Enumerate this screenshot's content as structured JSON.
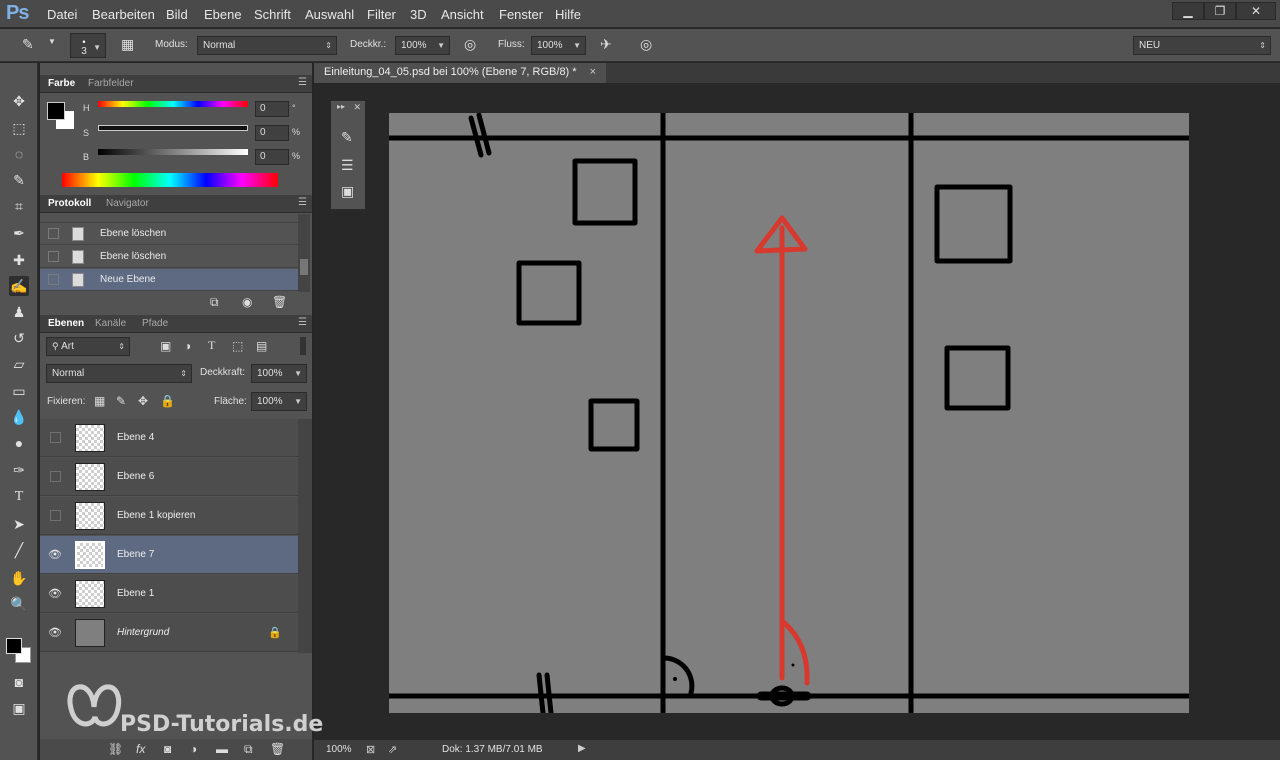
{
  "app": {
    "logo": "Ps"
  },
  "menubar": {
    "items": [
      "Datei",
      "Bearbeiten",
      "Bild",
      "Ebene",
      "Schrift",
      "Auswahl",
      "Filter",
      "3D",
      "Ansicht",
      "Fenster",
      "Hilfe"
    ]
  },
  "window_controls": {
    "minimize": "▁",
    "restore": "❐",
    "close": "✕"
  },
  "options_bar": {
    "brush_size": "3",
    "mode_label": "Modus:",
    "mode_value": "Normal",
    "opacity_label": "Deckkr.:",
    "opacity_value": "100%",
    "flow_label": "Fluss:",
    "flow_value": "100%",
    "workspace_value": "NEU"
  },
  "color_panel": {
    "tabs": [
      "Farbe",
      "Farbfelder"
    ],
    "sliders": [
      {
        "label": "H",
        "value": "0",
        "unit": "°"
      },
      {
        "label": "S",
        "value": "0",
        "unit": "%"
      },
      {
        "label": "B",
        "value": "0",
        "unit": "%"
      }
    ]
  },
  "history_panel": {
    "tabs": [
      "Protokoll",
      "Navigator"
    ],
    "items": [
      {
        "label": "Ebene löschen",
        "selected": false
      },
      {
        "label": "Ebene löschen",
        "selected": false
      },
      {
        "label": "Neue Ebene",
        "selected": true
      }
    ]
  },
  "layers_panel": {
    "tabs": [
      "Ebenen",
      "Kanäle",
      "Pfade"
    ],
    "filter_label": "Art",
    "blend_mode": "Normal",
    "opacity_label": "Deckkraft:",
    "opacity_value": "100%",
    "lock_label": "Fixieren:",
    "fill_label": "Fläche:",
    "fill_value": "100%",
    "layers": [
      {
        "name": "Ebene 4",
        "visible": false,
        "selected": false
      },
      {
        "name": "Ebene 6",
        "visible": false,
        "selected": false
      },
      {
        "name": "Ebene 1 kopieren",
        "visible": false,
        "selected": false
      },
      {
        "name": "Ebene 7",
        "visible": true,
        "selected": true
      },
      {
        "name": "Ebene 1",
        "visible": true,
        "selected": false
      },
      {
        "name": "Hintergrund",
        "visible": true,
        "selected": false,
        "locked": true
      }
    ],
    "footer_icons": [
      "link-icon",
      "fx-icon",
      "mask-icon",
      "adjustment-icon",
      "folder-icon",
      "new-layer-icon",
      "trash-icon"
    ]
  },
  "document": {
    "tab_title": "Einleitung_04_05.psd bei 100% (Ebene 7, RGB/8) *",
    "close": "×",
    "zoom": "100%",
    "doc_info": "Dok: 1.37 MB/7.01 MB"
  },
  "watermark": {
    "text": "PSD-Tutorials.de"
  },
  "colors": {
    "canvas": "#7f7f7f",
    "arrow": "#d8392f",
    "ink": "#000000",
    "selection": "#5d6a82"
  }
}
